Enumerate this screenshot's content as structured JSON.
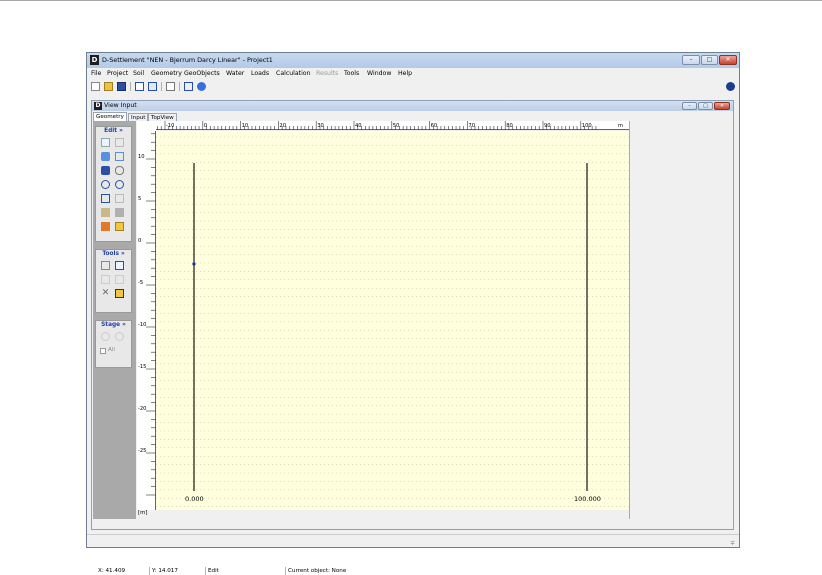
{
  "app": {
    "title": "D-Settlement \"NEN - Bjerrum Darcy Linear\" - Project1",
    "icon_letter": "D",
    "window_controls": [
      "minimize-icon",
      "maximize-icon",
      "close-icon"
    ]
  },
  "menu": [
    {
      "label": "File",
      "enabled": true
    },
    {
      "label": "Project",
      "enabled": true
    },
    {
      "label": "Soil",
      "enabled": true
    },
    {
      "label": "Geometry",
      "enabled": true
    },
    {
      "label": "GeoObjects",
      "enabled": true
    },
    {
      "label": "Water",
      "enabled": true
    },
    {
      "label": "Loads",
      "enabled": true
    },
    {
      "label": "Calculation",
      "enabled": true
    },
    {
      "label": "Results",
      "enabled": false
    },
    {
      "label": "Tools",
      "enabled": true
    },
    {
      "label": "Window",
      "enabled": true
    },
    {
      "label": "Help",
      "enabled": true
    }
  ],
  "toolbar": [
    "new-file-icon",
    "open-folder-icon",
    "save-icon",
    "print-preview-icon",
    "print-icon",
    "copy-icon",
    "calculator-icon",
    "help-icon"
  ],
  "child": {
    "title": "View Input",
    "icon_letter": "D",
    "tabs": [
      {
        "label": "Geometry",
        "active": true
      },
      {
        "label": "Input",
        "active": false
      },
      {
        "label": "TopView",
        "active": false
      }
    ]
  },
  "panels": {
    "edit": {
      "title": "Edit",
      "collapse": "»"
    },
    "tools": {
      "title": "Tools",
      "collapse": "»"
    },
    "stage": {
      "title": "Stage",
      "collapse": "»",
      "all_label": "All"
    }
  },
  "ruler_x_ticks": [
    "-10",
    "0",
    "10",
    "20",
    "30",
    "40",
    "50",
    "60",
    "70",
    "80",
    "90",
    "100"
  ],
  "ruler_x_unit": "m",
  "ruler_y_ticks": [
    "10",
    "5",
    "0",
    "-5",
    "-10",
    "-15",
    "-20",
    "-25"
  ],
  "ruler_y_corner": "[m]",
  "canvas": {
    "boundary_left_label": "0.000",
    "boundary_right_label": "100.000"
  },
  "status": {
    "x": "X: 41.409",
    "y": "Y: 14.017",
    "mode": "Edit",
    "object": "Current object: None"
  }
}
